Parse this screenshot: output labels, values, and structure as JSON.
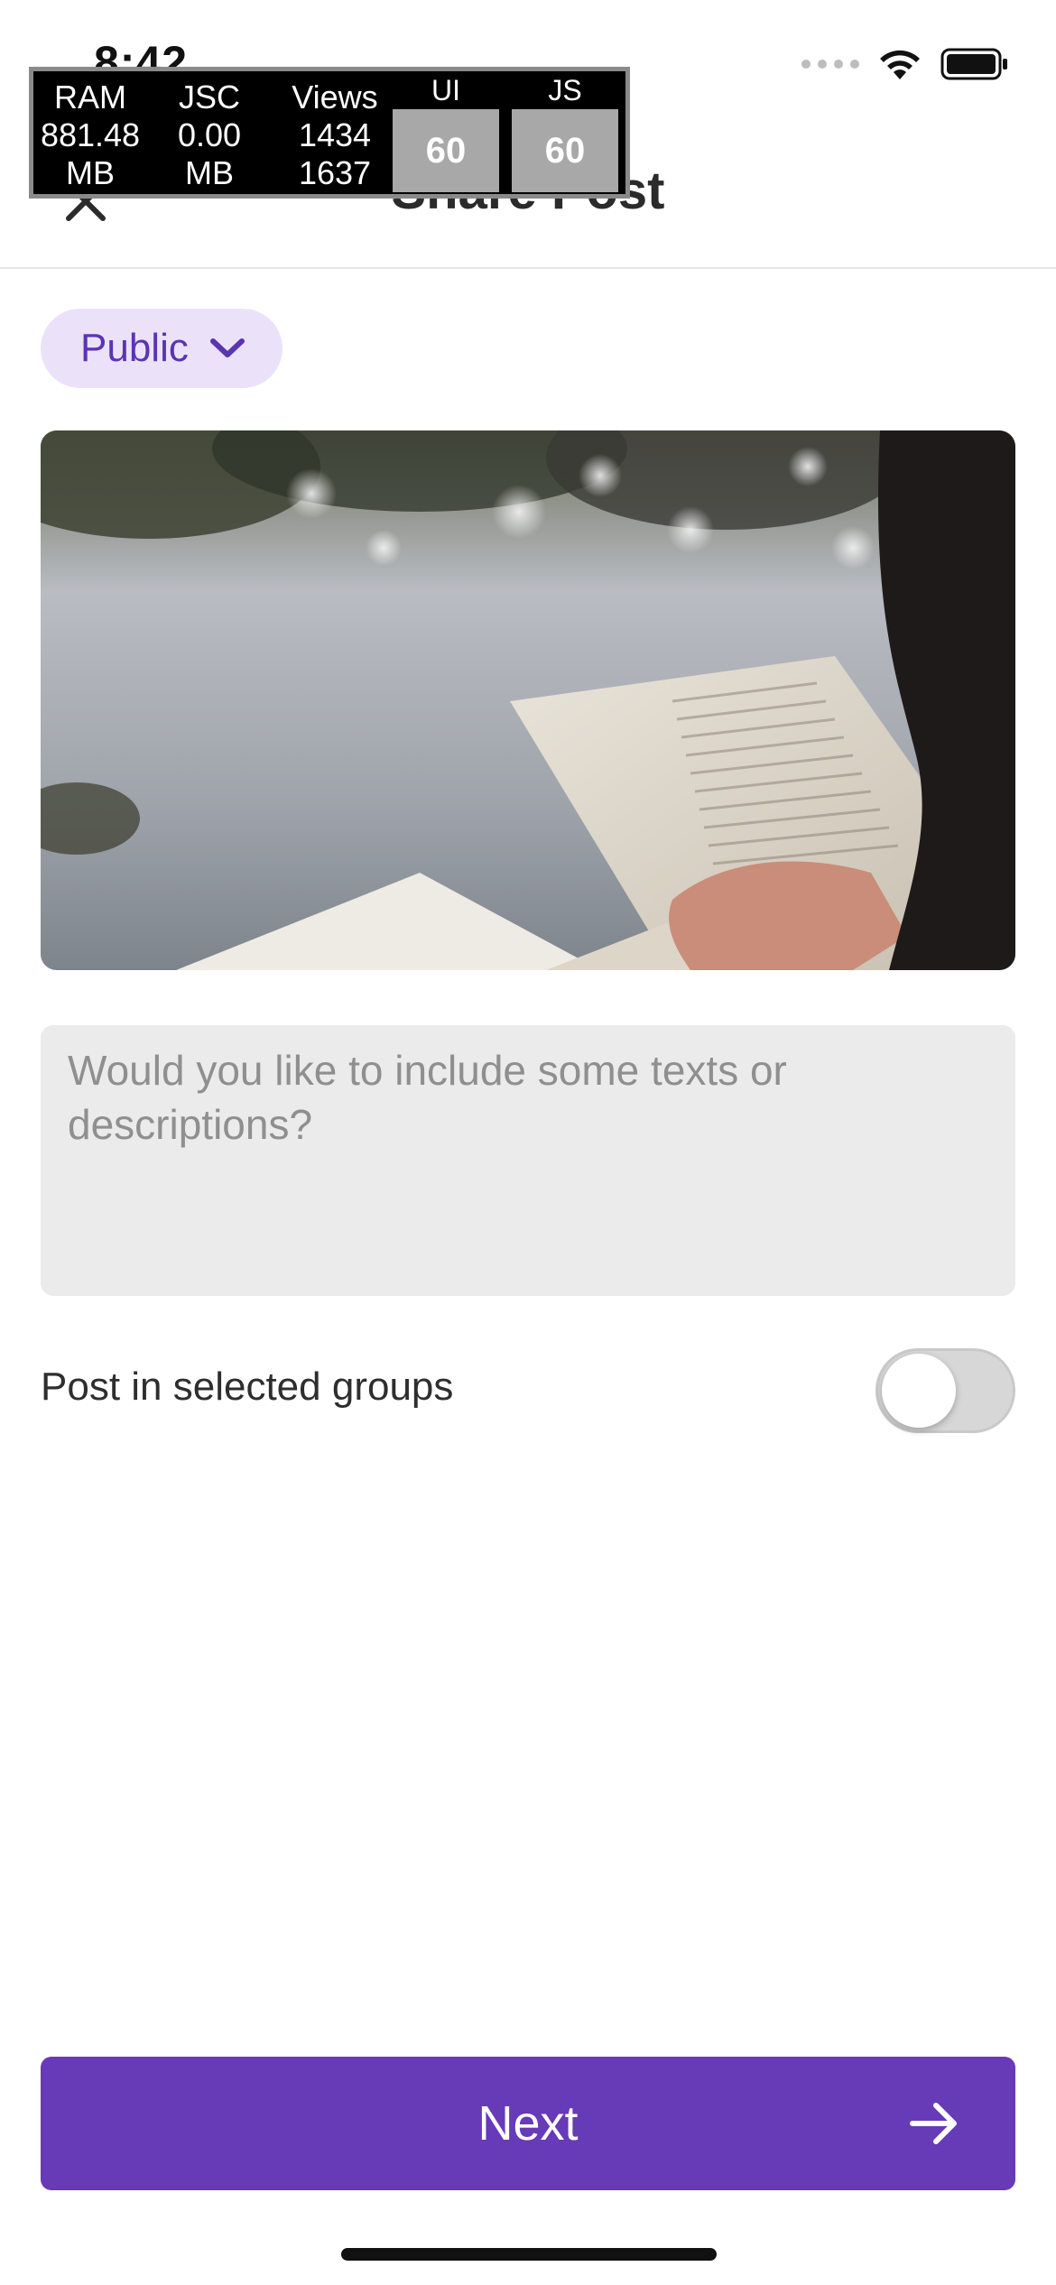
{
  "status_bar": {
    "time": "8:42",
    "icons": [
      "signal-icon",
      "wifi-icon",
      "battery-icon"
    ]
  },
  "header": {
    "title": "Share Post",
    "close_icon": "close-icon"
  },
  "perf_monitor": {
    "ram_label": "RAM",
    "ram_value": "881.48",
    "ram_unit": "MB",
    "jsc_label": "JSC",
    "jsc_value": "0.00",
    "jsc_unit": "MB",
    "views_label": "Views",
    "views_value_1": "1434",
    "views_value_2": "1637",
    "ui_label": "UI",
    "ui_fps": "60",
    "js_label": "JS",
    "js_fps": "60"
  },
  "privacy": {
    "label": "Public",
    "icon": "chevron-down-icon"
  },
  "post": {
    "caption_placeholder": "Would you like to include some texts or descriptions?",
    "caption_value": ""
  },
  "groups_toggle": {
    "label": "Post in selected groups",
    "on": false
  },
  "next_button": {
    "label": "Next",
    "icon": "arrow-right-icon"
  },
  "colors": {
    "accent": "#673ab7",
    "pill_bg": "#ebe2fa",
    "pill_text": "#5b34b1",
    "input_bg": "#ebebeb",
    "toggle_off": "#d7d7d7"
  }
}
